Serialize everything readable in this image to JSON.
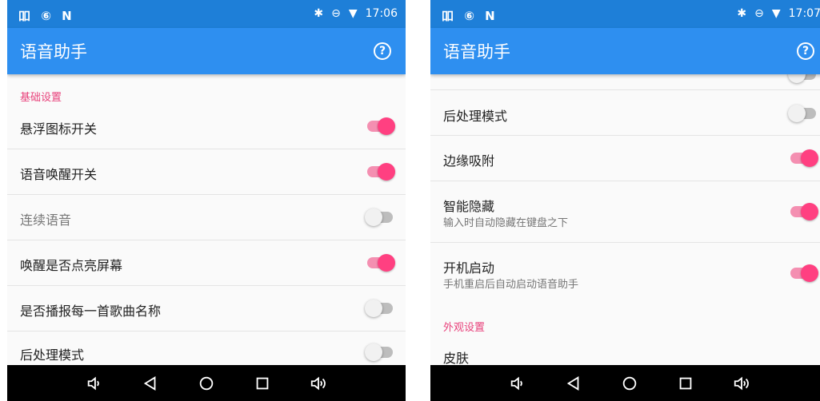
{
  "colors": {
    "statusbar": "#1e7fd8",
    "appbar": "#2e8ff0",
    "accent": "#ff4081",
    "section_header": "#e8417b"
  },
  "icons": {
    "status_left": [
      "listen-app-icon",
      "six-icon",
      "n-notification-icon"
    ],
    "status_right": [
      "bluetooth-icon",
      "do-not-disturb-icon",
      "wifi-icon"
    ],
    "help": "help-circle-icon",
    "nav": [
      "volume-down-icon",
      "back-icon",
      "home-icon",
      "recents-icon",
      "volume-up-icon"
    ]
  },
  "left": {
    "status": {
      "left_glyphs": "吅 ⑥ N",
      "time": "17:06"
    },
    "appbar": {
      "title": "语音助手",
      "help_glyph": "?"
    },
    "sections": [
      {
        "header": "基础设置"
      }
    ],
    "items": [
      {
        "title": "悬浮图标开关",
        "on": true
      },
      {
        "title": "语音唤醒开关",
        "on": true
      },
      {
        "title": "连续语音",
        "on": false
      },
      {
        "title": "唤醒是否点亮屏幕",
        "on": true
      },
      {
        "title": "是否播报每一首歌曲名称",
        "on": false
      },
      {
        "title": "后处理模式",
        "on": false
      }
    ]
  },
  "right": {
    "status": {
      "left_glyphs": "吅 ⑥ N",
      "time": "17:07"
    },
    "appbar": {
      "title": "语音助手",
      "help_glyph": "?"
    },
    "items": [
      {
        "title": "后处理模式",
        "on": false
      },
      {
        "title": "边缘吸附",
        "on": true
      },
      {
        "title": "智能隐藏",
        "summary": "输入时自动隐藏在键盘之下",
        "on": true
      },
      {
        "title": "开机启动",
        "summary": "手机重启后自动启动语音助手",
        "on": true
      }
    ],
    "sections": [
      {
        "header": "外观设置"
      }
    ],
    "items_after": [
      {
        "title": "皮肤"
      }
    ]
  }
}
